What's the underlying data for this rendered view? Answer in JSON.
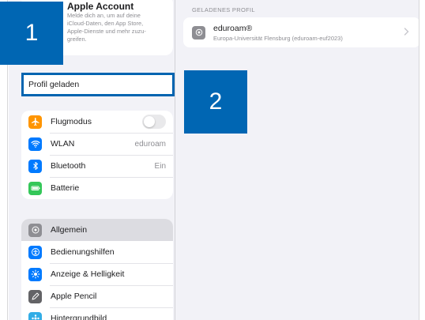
{
  "account": {
    "title": "Apple Account",
    "description": "Melde dich an, um auf deine\niCloud-Daten, den App Store,\nApple-Dienste und mehr zuzu-\ngreifen."
  },
  "profile_field": {
    "value": "Profil geladen"
  },
  "sidebar": {
    "group1": [
      {
        "label": "Flugmodus",
        "icon": "airplane-icon",
        "color": "#ff9500",
        "toggle": false
      },
      {
        "label": "WLAN",
        "icon": "wifi-icon",
        "color": "#007aff",
        "value": "eduroam"
      },
      {
        "label": "Bluetooth",
        "icon": "bluetooth-icon",
        "color": "#007aff",
        "value": "Ein"
      },
      {
        "label": "Batterie",
        "icon": "battery-icon",
        "color": "#34c759"
      }
    ],
    "group2": [
      {
        "label": "Allgemein",
        "icon": "gear-icon",
        "color": "#8e8e93",
        "selected": true
      },
      {
        "label": "Bedienungshilfen",
        "icon": "accessibility-icon",
        "color": "#007aff"
      },
      {
        "label": "Anzeige & Helligkeit",
        "icon": "sun-icon",
        "color": "#007aff"
      },
      {
        "label": "Apple Pencil",
        "icon": "pencil-icon",
        "color": "#636366"
      },
      {
        "label": "Hintergrundbild",
        "icon": "wallpaper-icon",
        "color": "#32ade6"
      }
    ]
  },
  "detail": {
    "section_header": "GELADENES PROFIL",
    "profile": {
      "name": "eduroam®",
      "subtitle": "Europa-Universität Flensburg (eduroam-euf2023)",
      "icon": "gear-icon"
    }
  },
  "badges": {
    "step1": "1",
    "step2": "2",
    "color": "#0066b3"
  }
}
